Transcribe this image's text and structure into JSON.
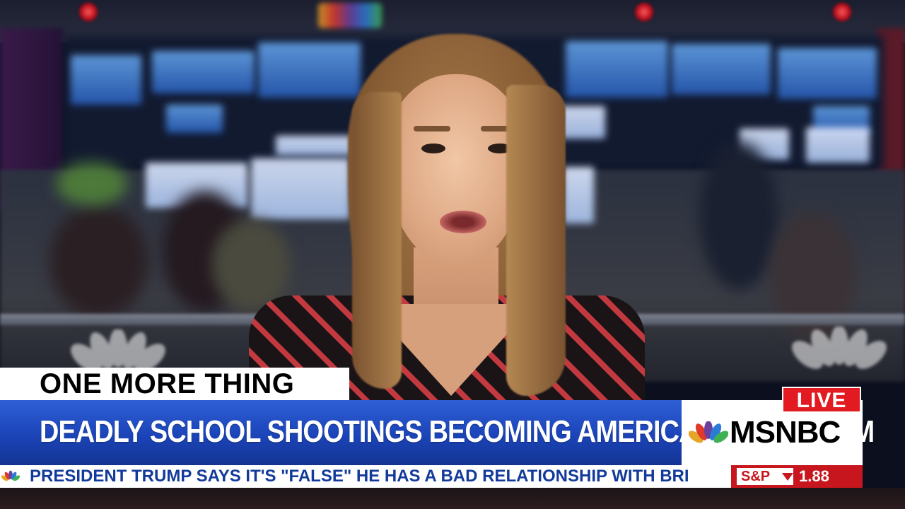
{
  "lower_third": {
    "segment_label": "ONE MORE THING",
    "headline": "DEADLY SCHOOL SHOOTINGS BECOMING AMERICA'S NEW NORM"
  },
  "network": {
    "name": "MSNBC",
    "live_badge": "LIVE",
    "logo_icon": "nbc-peacock-icon"
  },
  "ticker": {
    "icon": "nbc-peacock-icon",
    "text": "PRESIDENT TRUMP SAYS IT'S \"FALSE\" HE HAS A BAD RELATIONSHIP WITH BRI"
  },
  "market": {
    "index_label": "S&P",
    "direction_icon": "down-triangle-icon",
    "value": "1.88"
  },
  "colors": {
    "headline_blue": "#1b44b8",
    "live_red": "#e21b22",
    "ticker_text_blue": "#123a9a",
    "market_red": "#c8161e"
  }
}
